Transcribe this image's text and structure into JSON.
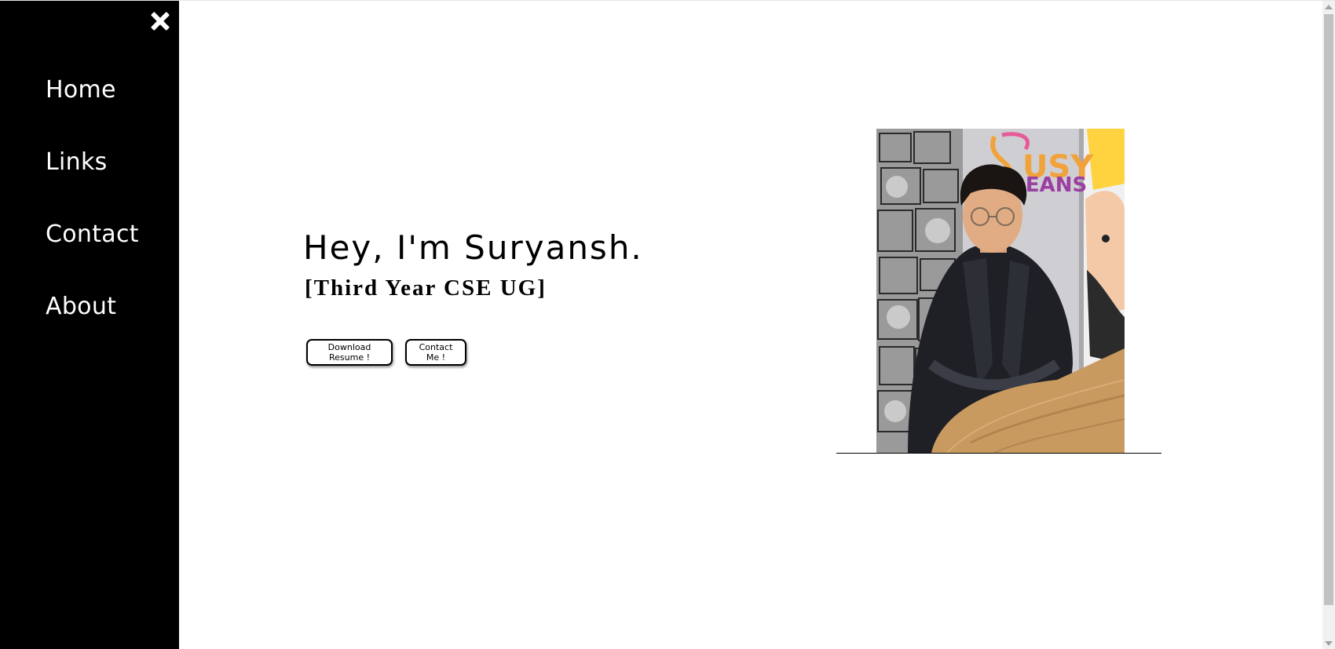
{
  "sidebar": {
    "close_icon": "close-icon",
    "items": [
      {
        "label": "Home"
      },
      {
        "label": "Links"
      },
      {
        "label": "Contact"
      },
      {
        "label": "About"
      }
    ]
  },
  "hero": {
    "title": "Hey, I'm Suryansh.",
    "subtitle": "[Third Year CSE UG]",
    "buttons": {
      "resume_label": "Download Resume !",
      "contact_label": "Contact Me !"
    }
  },
  "photo": {
    "sign_line1": "USY",
    "sign_line2": "BEANS"
  },
  "colors": {
    "sidebar_bg": "#000000",
    "sidebar_text": "#ffffff",
    "page_bg": "#ffffff",
    "text": "#000000"
  }
}
